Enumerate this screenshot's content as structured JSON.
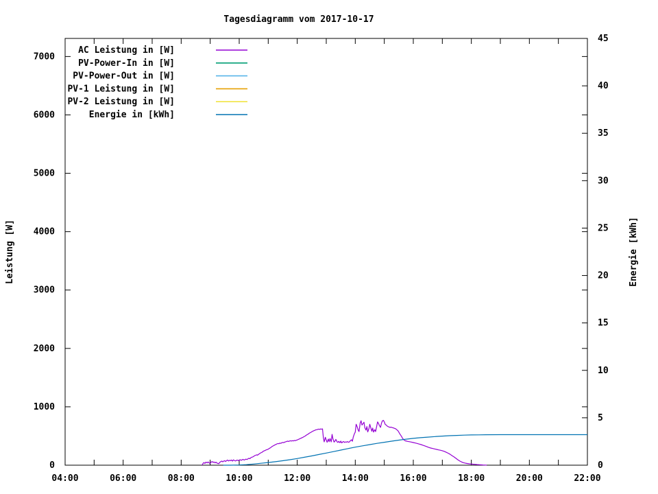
{
  "chart_data": {
    "type": "line",
    "title": "Tagesdiagramm vom 2017-10-17",
    "xlabel": "",
    "ylabel": "Leistung [W]",
    "y2label": "Energie [kWh]",
    "grid": false,
    "legend_position": "top-left-inside",
    "x_axis": {
      "range_hours": [
        4,
        22
      ],
      "major_tick_labels": [
        "04:00",
        "06:00",
        "08:00",
        "10:00",
        "12:00",
        "14:00",
        "16:00",
        "18:00",
        "20:00",
        "22:00"
      ],
      "major_tick_hours": [
        4,
        6,
        8,
        10,
        12,
        14,
        16,
        18,
        20,
        22
      ],
      "minor_tick_every_hours": 1
    },
    "y_left_axis": {
      "label": "Leistung [W]",
      "min": 0,
      "max": 7310,
      "tick_values": [
        0,
        1000,
        2000,
        3000,
        4000,
        5000,
        6000,
        7000
      ],
      "tick_labels": [
        "0",
        "1000",
        "2000",
        "3000",
        "4000",
        "5000",
        "6000",
        "7000"
      ]
    },
    "y_right_axis": {
      "label": "Energie [kWh]",
      "min": 0,
      "max": 45,
      "tick_values": [
        0,
        5,
        10,
        15,
        20,
        25,
        30,
        35,
        40,
        45
      ],
      "tick_labels": [
        "0",
        "5",
        "10",
        "15",
        "20",
        "25",
        "30",
        "35",
        "40",
        "45"
      ]
    },
    "series": [
      {
        "name": "AC Leistung in [W]",
        "color": "#9400d3",
        "axis": "left",
        "points": [
          [
            8.72,
            0
          ],
          [
            8.75,
            28
          ],
          [
            8.78,
            45
          ],
          [
            8.82,
            30
          ],
          [
            8.85,
            52
          ],
          [
            8.9,
            40
          ],
          [
            8.93,
            55
          ],
          [
            8.97,
            35
          ],
          [
            9.0,
            30
          ],
          [
            9.03,
            50
          ],
          [
            9.07,
            62
          ],
          [
            9.1,
            48
          ],
          [
            9.13,
            55
          ],
          [
            9.17,
            40
          ],
          [
            9.2,
            52
          ],
          [
            9.23,
            38
          ],
          [
            9.27,
            28
          ],
          [
            9.3,
            28
          ],
          [
            9.33,
            48
          ],
          [
            9.37,
            62
          ],
          [
            9.4,
            70
          ],
          [
            9.43,
            58
          ],
          [
            9.47,
            72
          ],
          [
            9.5,
            76
          ],
          [
            9.53,
            64
          ],
          [
            9.57,
            80
          ],
          [
            9.6,
            88
          ],
          [
            9.63,
            72
          ],
          [
            9.67,
            84
          ],
          [
            9.7,
            78
          ],
          [
            9.73,
            88
          ],
          [
            9.77,
            70
          ],
          [
            9.8,
            92
          ],
          [
            9.83,
            82
          ],
          [
            9.87,
            72
          ],
          [
            9.9,
            80
          ],
          [
            9.93,
            88
          ],
          [
            9.97,
            78
          ],
          [
            10.0,
            82
          ],
          [
            10.03,
            94
          ],
          [
            10.07,
            84
          ],
          [
            10.1,
            92
          ],
          [
            10.13,
            100
          ],
          [
            10.17,
            88
          ],
          [
            10.2,
            95
          ],
          [
            10.23,
            104
          ],
          [
            10.27,
            98
          ],
          [
            10.3,
            108
          ],
          [
            10.33,
            118
          ],
          [
            10.37,
            112
          ],
          [
            10.4,
            128
          ],
          [
            10.43,
            136
          ],
          [
            10.47,
            142
          ],
          [
            10.5,
            152
          ],
          [
            10.53,
            162
          ],
          [
            10.57,
            170
          ],
          [
            10.6,
            178
          ],
          [
            10.63,
            172
          ],
          [
            10.67,
            188
          ],
          [
            10.7,
            196
          ],
          [
            10.73,
            208
          ],
          [
            10.77,
            218
          ],
          [
            10.8,
            226
          ],
          [
            10.83,
            238
          ],
          [
            10.87,
            248
          ],
          [
            10.9,
            254
          ],
          [
            10.93,
            262
          ],
          [
            10.97,
            268
          ],
          [
            11.0,
            274
          ],
          [
            11.03,
            286
          ],
          [
            11.07,
            296
          ],
          [
            11.1,
            308
          ],
          [
            11.13,
            318
          ],
          [
            11.17,
            330
          ],
          [
            11.2,
            338
          ],
          [
            11.23,
            348
          ],
          [
            11.27,
            356
          ],
          [
            11.3,
            364
          ],
          [
            11.33,
            370
          ],
          [
            11.37,
            368
          ],
          [
            11.4,
            378
          ],
          [
            11.43,
            374
          ],
          [
            11.47,
            384
          ],
          [
            11.5,
            390
          ],
          [
            11.53,
            386
          ],
          [
            11.57,
            396
          ],
          [
            11.6,
            400
          ],
          [
            11.63,
            406
          ],
          [
            11.67,
            412
          ],
          [
            11.7,
            406
          ],
          [
            11.73,
            414
          ],
          [
            11.77,
            418
          ],
          [
            11.8,
            414
          ],
          [
            11.83,
            420
          ],
          [
            11.87,
            416
          ],
          [
            11.9,
            424
          ],
          [
            11.93,
            420
          ],
          [
            11.97,
            428
          ],
          [
            12.0,
            432
          ],
          [
            12.03,
            440
          ],
          [
            12.07,
            448
          ],
          [
            12.1,
            456
          ],
          [
            12.13,
            462
          ],
          [
            12.17,
            472
          ],
          [
            12.2,
            478
          ],
          [
            12.23,
            488
          ],
          [
            12.27,
            498
          ],
          [
            12.3,
            510
          ],
          [
            12.33,
            520
          ],
          [
            12.37,
            530
          ],
          [
            12.4,
            542
          ],
          [
            12.43,
            552
          ],
          [
            12.47,
            562
          ],
          [
            12.5,
            572
          ],
          [
            12.53,
            580
          ],
          [
            12.57,
            590
          ],
          [
            12.6,
            596
          ],
          [
            12.63,
            604
          ],
          [
            12.67,
            608
          ],
          [
            12.7,
            612
          ],
          [
            12.73,
            618
          ],
          [
            12.77,
            614
          ],
          [
            12.8,
            620
          ],
          [
            12.83,
            616
          ],
          [
            12.87,
            622
          ],
          [
            12.9,
            470
          ],
          [
            12.93,
            400
          ],
          [
            12.97,
            478
          ],
          [
            13.0,
            430
          ],
          [
            13.03,
            392
          ],
          [
            13.07,
            448
          ],
          [
            13.1,
            402
          ],
          [
            13.13,
            456
          ],
          [
            13.17,
            400
          ],
          [
            13.2,
            528
          ],
          [
            13.23,
            452
          ],
          [
            13.27,
            396
          ],
          [
            13.3,
            414
          ],
          [
            13.33,
            442
          ],
          [
            13.37,
            402
          ],
          [
            13.4,
            390
          ],
          [
            13.43,
            408
          ],
          [
            13.47,
            386
          ],
          [
            13.5,
            412
          ],
          [
            13.53,
            382
          ],
          [
            13.57,
            398
          ],
          [
            13.6,
            406
          ],
          [
            13.63,
            390
          ],
          [
            13.67,
            400
          ],
          [
            13.7,
            394
          ],
          [
            13.73,
            404
          ],
          [
            13.77,
            392
          ],
          [
            13.8,
            400
          ],
          [
            13.83,
            418
          ],
          [
            13.87,
            436
          ],
          [
            13.9,
            410
          ],
          [
            13.93,
            482
          ],
          [
            13.97,
            540
          ],
          [
            14.0,
            566
          ],
          [
            14.03,
            700
          ],
          [
            14.07,
            652
          ],
          [
            14.1,
            600
          ],
          [
            14.13,
            576
          ],
          [
            14.17,
            722
          ],
          [
            14.2,
            762
          ],
          [
            14.23,
            688
          ],
          [
            14.27,
            714
          ],
          [
            14.3,
            736
          ],
          [
            14.33,
            640
          ],
          [
            14.37,
            600
          ],
          [
            14.4,
            662
          ],
          [
            14.43,
            570
          ],
          [
            14.47,
            624
          ],
          [
            14.5,
            700
          ],
          [
            14.53,
            648
          ],
          [
            14.57,
            580
          ],
          [
            14.6,
            636
          ],
          [
            14.63,
            566
          ],
          [
            14.67,
            608
          ],
          [
            14.7,
            576
          ],
          [
            14.73,
            646
          ],
          [
            14.77,
            742
          ],
          [
            14.8,
            716
          ],
          [
            14.83,
            680
          ],
          [
            14.87,
            648
          ],
          [
            14.9,
            710
          ],
          [
            14.93,
            756
          ],
          [
            14.97,
            768
          ],
          [
            15.0,
            740
          ],
          [
            15.03,
            700
          ],
          [
            15.07,
            686
          ],
          [
            15.1,
            670
          ],
          [
            15.13,
            660
          ],
          [
            15.17,
            654
          ],
          [
            15.2,
            648
          ],
          [
            15.23,
            652
          ],
          [
            15.27,
            644
          ],
          [
            15.3,
            640
          ],
          [
            15.33,
            636
          ],
          [
            15.37,
            628
          ],
          [
            15.4,
            620
          ],
          [
            15.43,
            608
          ],
          [
            15.47,
            590
          ],
          [
            15.5,
            568
          ],
          [
            15.53,
            540
          ],
          [
            15.57,
            510
          ],
          [
            15.6,
            486
          ],
          [
            15.63,
            460
          ],
          [
            15.67,
            438
          ],
          [
            15.7,
            424
          ],
          [
            15.73,
            416
          ],
          [
            15.77,
            412
          ],
          [
            15.8,
            408
          ],
          [
            15.87,
            402
          ],
          [
            15.93,
            396
          ],
          [
            16.0,
            388
          ],
          [
            16.07,
            380
          ],
          [
            16.13,
            372
          ],
          [
            16.2,
            362
          ],
          [
            16.27,
            352
          ],
          [
            16.33,
            342
          ],
          [
            16.4,
            330
          ],
          [
            16.47,
            316
          ],
          [
            16.53,
            304
          ],
          [
            16.6,
            294
          ],
          [
            16.67,
            286
          ],
          [
            16.73,
            278
          ],
          [
            16.8,
            270
          ],
          [
            16.87,
            262
          ],
          [
            16.93,
            256
          ],
          [
            17.0,
            248
          ],
          [
            17.07,
            236
          ],
          [
            17.13,
            222
          ],
          [
            17.2,
            206
          ],
          [
            17.27,
            186
          ],
          [
            17.33,
            164
          ],
          [
            17.4,
            142
          ],
          [
            17.47,
            118
          ],
          [
            17.53,
            94
          ],
          [
            17.6,
            72
          ],
          [
            17.67,
            54
          ],
          [
            17.73,
            42
          ],
          [
            17.8,
            34
          ],
          [
            17.87,
            28
          ],
          [
            17.93,
            24
          ],
          [
            18.0,
            20
          ],
          [
            18.07,
            16
          ],
          [
            18.13,
            14
          ],
          [
            18.2,
            10
          ],
          [
            18.27,
            8
          ],
          [
            18.33,
            6
          ],
          [
            18.4,
            4
          ],
          [
            18.47,
            2
          ],
          [
            18.53,
            0
          ]
        ]
      },
      {
        "name": "PV-Power-In in [W]",
        "color": "#009e73",
        "axis": "left",
        "points": []
      },
      {
        "name": "PV-Power-Out in [W]",
        "color": "#56b4e9",
        "axis": "left",
        "points": []
      },
      {
        "name": "PV-1 Leistung in [W]",
        "color": "#e69f00",
        "axis": "left",
        "points": []
      },
      {
        "name": "PV-2 Leistung in [W]",
        "color": "#f0e442",
        "axis": "left",
        "points": []
      },
      {
        "name": "Energie in [kWh]",
        "color": "#0072b2",
        "axis": "right",
        "points": [
          [
            9.45,
            0
          ],
          [
            9.7,
            0
          ],
          [
            10.0,
            0.02
          ],
          [
            10.25,
            0.06
          ],
          [
            10.5,
            0.12
          ],
          [
            10.75,
            0.2
          ],
          [
            11.0,
            0.28
          ],
          [
            11.25,
            0.37
          ],
          [
            11.5,
            0.47
          ],
          [
            11.75,
            0.58
          ],
          [
            12.0,
            0.7
          ],
          [
            12.25,
            0.84
          ],
          [
            12.5,
            0.98
          ],
          [
            12.75,
            1.13
          ],
          [
            13.0,
            1.28
          ],
          [
            13.25,
            1.43
          ],
          [
            13.5,
            1.59
          ],
          [
            13.75,
            1.75
          ],
          [
            14.0,
            1.9
          ],
          [
            14.25,
            2.04
          ],
          [
            14.5,
            2.17
          ],
          [
            14.75,
            2.3
          ],
          [
            15.0,
            2.42
          ],
          [
            15.25,
            2.53
          ],
          [
            15.5,
            2.64
          ],
          [
            15.75,
            2.74
          ],
          [
            16.0,
            2.83
          ],
          [
            16.25,
            2.9
          ],
          [
            16.5,
            2.96
          ],
          [
            16.75,
            3.02
          ],
          [
            17.0,
            3.07
          ],
          [
            17.25,
            3.11
          ],
          [
            17.5,
            3.14
          ],
          [
            17.75,
            3.17
          ],
          [
            18.0,
            3.19
          ],
          [
            18.25,
            3.2
          ],
          [
            18.5,
            3.21
          ],
          [
            19.0,
            3.22
          ],
          [
            20.0,
            3.22
          ],
          [
            21.0,
            3.22
          ],
          [
            22.0,
            3.22
          ]
        ]
      }
    ]
  }
}
